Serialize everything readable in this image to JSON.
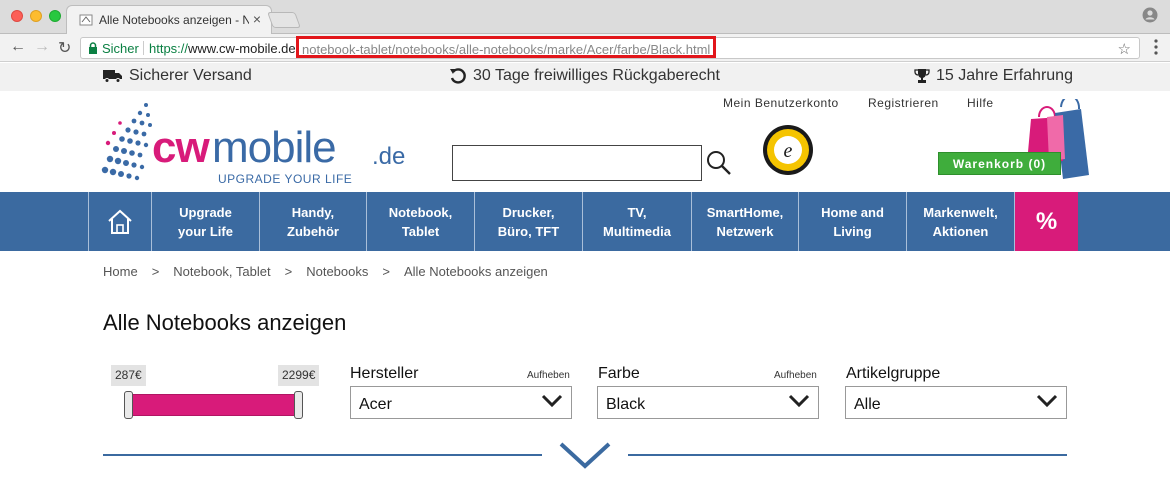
{
  "browser": {
    "tab_title": "Alle Notebooks anzeigen - Not",
    "tab_close": "×",
    "secure_label": "Sicher",
    "url_https": "https://",
    "url_host": "www.cw-mobile.de",
    "url_path": "notebook-tablet/notebooks/alle-notebooks/marke/Acer/farbe/Black.html",
    "back_glyph": "←",
    "forward_glyph": "→",
    "reload_glyph": "↻",
    "star_glyph": "☆"
  },
  "infobar": {
    "shipping": "Sicherer Versand",
    "returns": "30 Tage freiwilliges Rückgaberecht",
    "experience": "15 Jahre Erfahrung"
  },
  "header": {
    "logo_cw": "cw",
    "logo_mobile": "mobile",
    "logo_de": ".de",
    "logo_tagline": "UPGRADE YOUR LIFE",
    "links": [
      "Mein Benutzerkonto",
      "Registrieren",
      "Hilfe"
    ],
    "search_placeholder": "",
    "cart_label": "Warenkorb (0)"
  },
  "nav": {
    "items": [
      "Upgrade\nyour Life",
      "Handy,\nZubehör",
      "Notebook,\nTablet",
      "Drucker,\nBüro, TFT",
      "TV,\nMultimedia",
      "SmartHome,\nNetzwerk",
      "Home and\nLiving",
      "Markenwelt,\nAktionen"
    ],
    "sale_label": "%"
  },
  "breadcrumb": {
    "items": [
      "Home",
      "Notebook, Tablet",
      "Notebooks",
      "Alle Notebooks anzeigen"
    ],
    "separator": ">"
  },
  "page": {
    "title": "Alle Notebooks anzeigen"
  },
  "filters": {
    "price_min": "287€",
    "price_max": "2299€",
    "manufacturer_label": "Hersteller",
    "manufacturer_clear": "Aufheben",
    "manufacturer_value": "Acer",
    "color_label": "Farbe",
    "color_clear": "Aufheben",
    "color_value": "Black",
    "group_label": "Artikelgruppe",
    "group_value": "Alle"
  },
  "colors": {
    "brand_blue": "#3b6aa0",
    "brand_pink": "#d81b7a",
    "cart_green": "#3fad3c",
    "url_highlight": "#e2161b"
  }
}
